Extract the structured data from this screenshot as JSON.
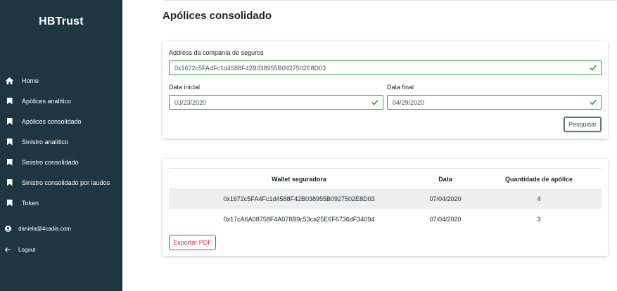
{
  "app": {
    "logo": "HBTrust"
  },
  "sidebar": {
    "items": [
      {
        "label": "Home",
        "icon": "home-icon"
      },
      {
        "label": "Apólices analítico",
        "icon": "bookmark-icon"
      },
      {
        "label": "Apólices consolidado",
        "icon": "bookmark-icon"
      },
      {
        "label": "Sinistro analítico",
        "icon": "bookmark-icon"
      },
      {
        "label": "Sinistro consolidado",
        "icon": "bookmark-icon"
      },
      {
        "label": "Sinistro consolidado por laudos",
        "icon": "bookmark-icon"
      },
      {
        "label": "Token",
        "icon": "bookmark-icon"
      }
    ],
    "user": {
      "email": "daniela@4cadia.com",
      "icon": "user-icon"
    },
    "logout": {
      "label": "Logout",
      "icon": "arrow-left-icon"
    }
  },
  "page": {
    "title": "Apólices consolidado"
  },
  "form": {
    "address_label": "Address da companía de seguros",
    "address_value": "0x1672c5FA4Fc1d4588F42B038955B0927502E8D03",
    "start_label": "Data inicial",
    "start_value": "03/23/2020",
    "end_label": "Data final",
    "end_value": "04/29/2020",
    "search_button": "Pesquisar"
  },
  "table": {
    "headers": [
      "Wallet seguradora",
      "Data",
      "Quantidade de apólice"
    ],
    "rows": [
      [
        "0x1672c5FA4Fc1d4588F42B038955B0927502E8D03",
        "07/04/2020",
        "4"
      ],
      [
        "0x17cA6A08758F4A078B9c53ca25E6F6736dF34094",
        "07/04/2020",
        "3"
      ]
    ],
    "export_button": "Exportar PDF"
  },
  "colors": {
    "sidebar_bg": "#1e3641",
    "valid_green": "#28a745",
    "export_red": "#dc3545",
    "stripe": "#efefef"
  }
}
